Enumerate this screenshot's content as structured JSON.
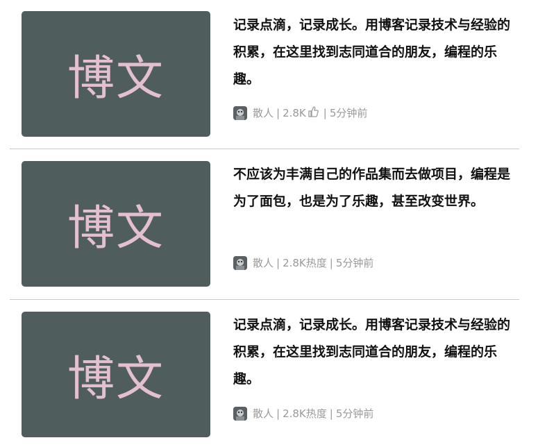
{
  "articles": [
    {
      "thumb_text": "博文",
      "title": "记录点滴，记录成长。用博客记录技术与经验的积累，在这里找到志同道合的朋友，编程的乐趣。",
      "author": "散人",
      "count": "2.8K",
      "count_icon": "thumbs-up-icon",
      "time": "5分钟前"
    },
    {
      "thumb_text": "博文",
      "title": "不应该为丰满自己的作品集而去做项目，编程是为了面包，也是为了乐趣，甚至改变世界。",
      "author": "散人",
      "count": "2.8K热度",
      "time": "5分钟前"
    },
    {
      "thumb_text": "博文",
      "title": "记录点滴，记录成长。用博客记录技术与经验的积累，在这里找到志同道合的朋友，编程的乐趣。",
      "author": "散人",
      "count": "2.8K热度",
      "time": "5分钟前"
    }
  ],
  "separator": "|",
  "colors": {
    "thumb_bg": "#4f5d5d",
    "thumb_text": "#e3c0cf",
    "meta": "#9a9a9a",
    "title": "#111111"
  }
}
